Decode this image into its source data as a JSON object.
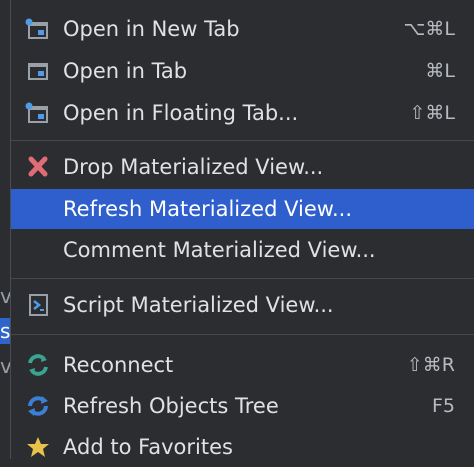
{
  "menu": {
    "items": [
      {
        "label": "Open in New Tab",
        "shortcut": "⌥⌘L",
        "icon": "open-new-tab-icon"
      },
      {
        "label": "Open in Tab",
        "shortcut": "⌘L",
        "icon": "open-tab-icon"
      },
      {
        "label": "Open in Floating Tab...",
        "shortcut": "⇧⌘L",
        "icon": "open-floating-tab-icon"
      },
      {
        "label": "Drop Materialized View...",
        "shortcut": "",
        "icon": "drop-x-icon"
      },
      {
        "label": "Refresh Materialized View...",
        "shortcut": "",
        "icon": ""
      },
      {
        "label": "Comment Materialized View...",
        "shortcut": "",
        "icon": ""
      },
      {
        "label": "Script Materialized View...",
        "shortcut": "",
        "icon": "script-icon"
      },
      {
        "label": "Reconnect",
        "shortcut": "⇧⌘R",
        "icon": "reconnect-icon"
      },
      {
        "label": "Refresh Objects Tree",
        "shortcut": "F5",
        "icon": "refresh-icon"
      },
      {
        "label": "Add to Favorites",
        "shortcut": "",
        "icon": "star-icon"
      }
    ],
    "selected_index": 4
  },
  "background": {
    "fragments": [
      "v",
      "s",
      "v"
    ]
  },
  "colors": {
    "menu_bg": "#2b2d30",
    "selection": "#2e5fcc",
    "text": "#dfe1e5",
    "drop_icon": "#e06c75",
    "reconnect_icon": "#3aa391",
    "refresh_icon": "#3c7fd6"
  }
}
